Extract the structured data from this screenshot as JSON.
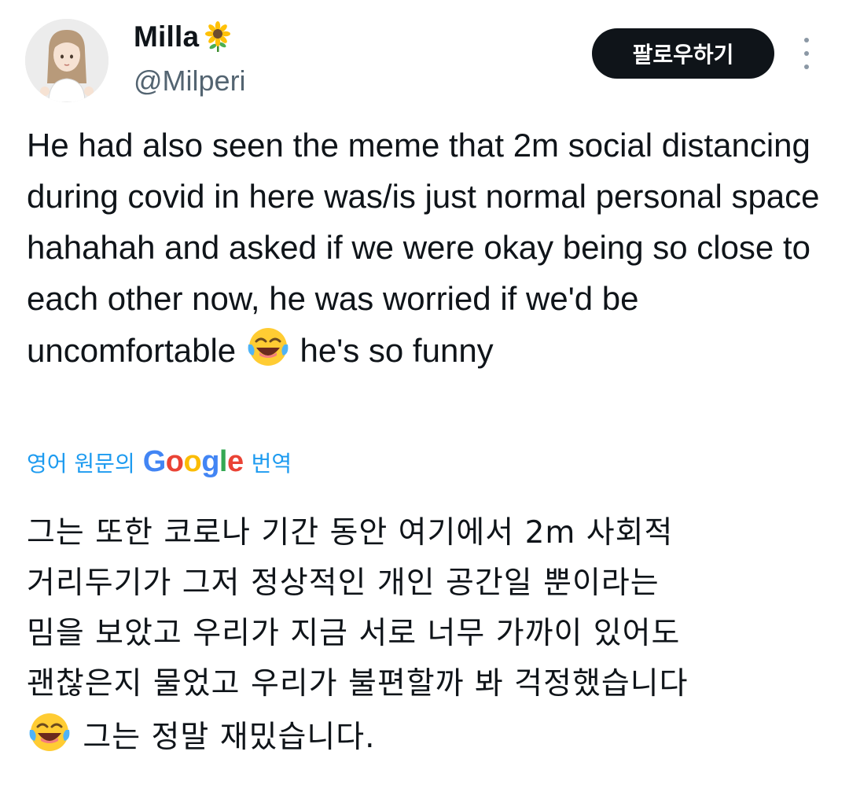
{
  "author": {
    "display_name": "Milla",
    "name_emoji": "sunflower-icon",
    "handle": "@Milperi"
  },
  "actions": {
    "follow_label": "팔로우하기",
    "more_icon": "more-vertical-icon"
  },
  "tweet": {
    "text_before_emoji": "He had also seen the meme that 2m social distancing during covid in here was/is just normal personal space hahahah and asked if we were okay being so close to each other now, he was worried if we'd be uncomfortable ",
    "emoji": "face-with-tears-of-joy-icon",
    "text_after_emoji": " he's so funny"
  },
  "translation": {
    "prefix": "영어 원문의",
    "google_letters": [
      "G",
      "o",
      "o",
      "g",
      "l",
      "e"
    ],
    "suffix": "번역",
    "text_line_1": "그는 또한 코로나 기간 동안 여기에서 2m 사회적",
    "text_line_2": "거리두기가 그저 정상적인 개인 공간일 뿐이라는",
    "text_line_3": "밈을 보았고 우리가 지금 서로 너무 가까이 있어도",
    "text_line_4": "괜찮은지 물었고 우리가 불편할까 봐 걱정했습니다",
    "text_line_5": " 그는 정말 재밌습니다."
  },
  "colors": {
    "link": "#1d9bf0",
    "follow_button_bg": "#0f1419",
    "secondary_text": "#536471"
  }
}
